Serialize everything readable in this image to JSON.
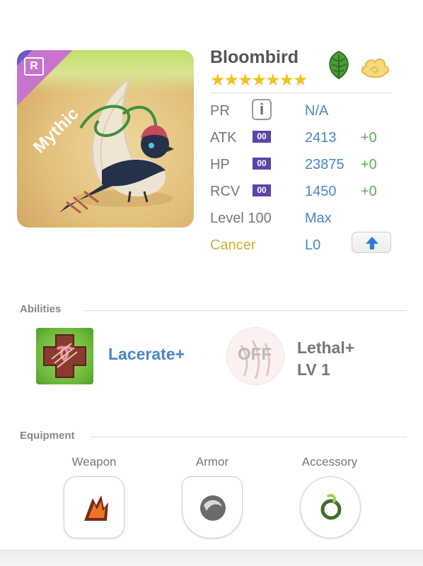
{
  "monster": {
    "name": "Bloombird",
    "stars": "★★★★★★★",
    "rarity": "Mythic",
    "rank_letter": "R",
    "zodiac_symbol": "♋",
    "element_icons": [
      "leaf-icon",
      "cloud-icon"
    ]
  },
  "stats": {
    "pr": {
      "label": "PR",
      "value": "N/A"
    },
    "atk": {
      "label": "ATK",
      "tag": "00",
      "value": "2413",
      "bonus": "+0"
    },
    "hp": {
      "label": "HP",
      "tag": "00",
      "value": "23875",
      "bonus": "+0"
    },
    "rcv": {
      "label": "RCV",
      "tag": "00",
      "value": "1450",
      "bonus": "+0"
    },
    "level": {
      "label": "Level 100",
      "value": "Max"
    },
    "sign": {
      "label": "Cancer",
      "value": "L0"
    }
  },
  "abilities": {
    "title": "Abilities",
    "active": {
      "name": "Lacerate+"
    },
    "leader": {
      "status": "OFF",
      "name": "Lethal+",
      "level": "LV 1"
    }
  },
  "equipment": {
    "title": "Equipment",
    "slots": [
      {
        "label": "Weapon"
      },
      {
        "label": "Armor"
      },
      {
        "label": "Accessory"
      }
    ]
  },
  "colors": {
    "accent_blue": "#4b86c6",
    "bonus_green": "#5caf55",
    "star_yellow": "#f1c21e",
    "mythic_pink": "#c874cf",
    "rank_purple": "#6a56c7"
  }
}
